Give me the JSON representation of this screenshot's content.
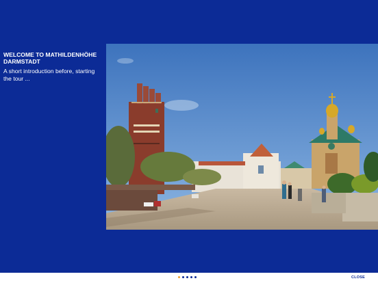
{
  "intro": {
    "title": "WELCOME TO MATHILDENHÖHE DARMSTADT",
    "text": "A short introduction before, starting the tour ..."
  },
  "photo": {
    "subject": "Mathildenhöhe Darmstadt — Wedding Tower, Exhibition Hall and Russian Chapel"
  },
  "pager": {
    "total": 5,
    "current": 1
  },
  "footer": {
    "close_label": "CLOSE"
  },
  "colors": {
    "background": "#0c2b96",
    "footer": "#ffffff",
    "active_dot": "#f0a030"
  }
}
